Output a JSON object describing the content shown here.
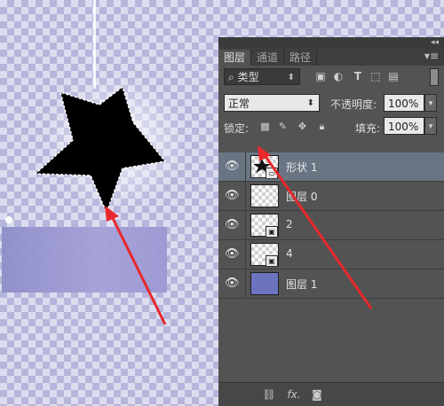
{
  "panel": {
    "collapse_glyph": "◂◂",
    "tabs": [
      {
        "label": "图层",
        "active": true
      },
      {
        "label": "通道",
        "active": false
      },
      {
        "label": "路径",
        "active": false
      }
    ],
    "menu_icon": "panel-menu-icon",
    "filter": {
      "search_glyph": "⌕",
      "label": "类型",
      "icons": [
        "image-filter-icon",
        "adjustment-filter-icon",
        "text-filter-icon",
        "shape-filter-icon",
        "smart-object-filter-icon"
      ]
    },
    "blend_mode": "正常",
    "opacity_label": "不透明度:",
    "opacity_value": "100%",
    "lock_label": "锁定:",
    "fill_label": "填充:",
    "fill_value": "100%",
    "layers": [
      {
        "name": "形状 1",
        "selected": true,
        "thumb": "shape",
        "badge": true
      },
      {
        "name": "图层 0",
        "selected": false,
        "thumb": "transparent",
        "badge": false
      },
      {
        "name": "2",
        "selected": false,
        "thumb": "transparent",
        "badge": true
      },
      {
        "name": "4",
        "selected": false,
        "thumb": "transparent",
        "badge": true
      },
      {
        "name": "图层 1",
        "selected": false,
        "thumb": "fill",
        "badge": false
      }
    ],
    "bottom_icons": [
      "link-icon",
      "fx-icon",
      "mask-icon"
    ],
    "fx_label": "fx."
  },
  "colors": {
    "annotation_arrow": "#e8282c",
    "selected_layer": "#6a7583",
    "fill_layer": "#6c74c0"
  }
}
